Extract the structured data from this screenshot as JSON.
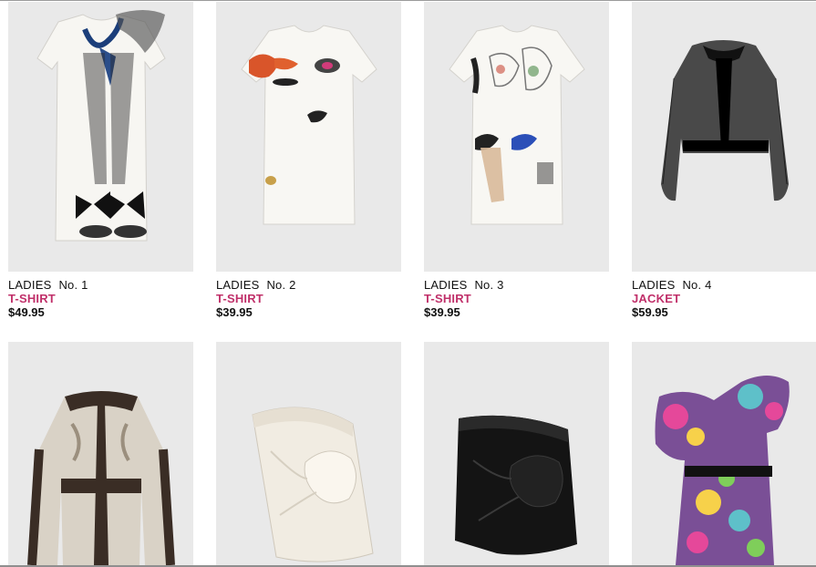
{
  "colors": {
    "tile_background": "#e9e9e9",
    "category_accent": "#c0306a",
    "text": "#111111"
  },
  "products": [
    {
      "dept": "LADIES",
      "number": "No. 1",
      "category": "T-SHIRT",
      "price": "$49.95",
      "image": "tshirt-stockings-bows-illustration"
    },
    {
      "dept": "LADIES",
      "number": "No. 2",
      "category": "T-SHIRT",
      "price": "$39.95",
      "image": "tshirt-face-bows-lips"
    },
    {
      "dept": "LADIES",
      "number": "No. 3",
      "category": "T-SHIRT",
      "price": "$39.95",
      "image": "tshirt-sketch-bows"
    },
    {
      "dept": "LADIES",
      "number": "No. 4",
      "category": "JACKET",
      "price": "$59.95",
      "image": "sheer-black-bomber-jacket"
    },
    {
      "image": "faux-fur-jacket"
    },
    {
      "image": "white-draped-skirt"
    },
    {
      "image": "black-draped-skirt"
    },
    {
      "image": "floral-one-shoulder-dress"
    }
  ]
}
